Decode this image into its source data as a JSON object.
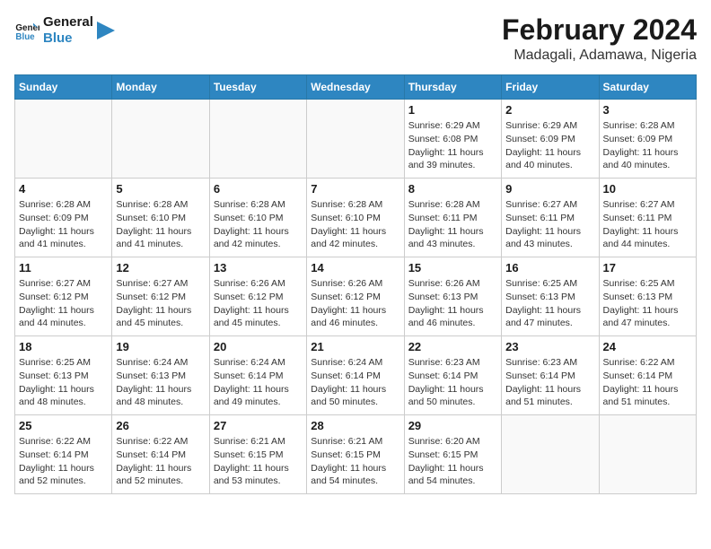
{
  "logo": {
    "text_general": "General",
    "text_blue": "Blue"
  },
  "title": "February 2024",
  "subtitle": "Madagali, Adamawa, Nigeria",
  "days_header": [
    "Sunday",
    "Monday",
    "Tuesday",
    "Wednesday",
    "Thursday",
    "Friday",
    "Saturday"
  ],
  "weeks": [
    [
      {
        "day": "",
        "info": ""
      },
      {
        "day": "",
        "info": ""
      },
      {
        "day": "",
        "info": ""
      },
      {
        "day": "",
        "info": ""
      },
      {
        "day": "1",
        "info": "Sunrise: 6:29 AM\nSunset: 6:08 PM\nDaylight: 11 hours and 39 minutes."
      },
      {
        "day": "2",
        "info": "Sunrise: 6:29 AM\nSunset: 6:09 PM\nDaylight: 11 hours and 40 minutes."
      },
      {
        "day": "3",
        "info": "Sunrise: 6:28 AM\nSunset: 6:09 PM\nDaylight: 11 hours and 40 minutes."
      }
    ],
    [
      {
        "day": "4",
        "info": "Sunrise: 6:28 AM\nSunset: 6:09 PM\nDaylight: 11 hours and 41 minutes."
      },
      {
        "day": "5",
        "info": "Sunrise: 6:28 AM\nSunset: 6:10 PM\nDaylight: 11 hours and 41 minutes."
      },
      {
        "day": "6",
        "info": "Sunrise: 6:28 AM\nSunset: 6:10 PM\nDaylight: 11 hours and 42 minutes."
      },
      {
        "day": "7",
        "info": "Sunrise: 6:28 AM\nSunset: 6:10 PM\nDaylight: 11 hours and 42 minutes."
      },
      {
        "day": "8",
        "info": "Sunrise: 6:28 AM\nSunset: 6:11 PM\nDaylight: 11 hours and 43 minutes."
      },
      {
        "day": "9",
        "info": "Sunrise: 6:27 AM\nSunset: 6:11 PM\nDaylight: 11 hours and 43 minutes."
      },
      {
        "day": "10",
        "info": "Sunrise: 6:27 AM\nSunset: 6:11 PM\nDaylight: 11 hours and 44 minutes."
      }
    ],
    [
      {
        "day": "11",
        "info": "Sunrise: 6:27 AM\nSunset: 6:12 PM\nDaylight: 11 hours and 44 minutes."
      },
      {
        "day": "12",
        "info": "Sunrise: 6:27 AM\nSunset: 6:12 PM\nDaylight: 11 hours and 45 minutes."
      },
      {
        "day": "13",
        "info": "Sunrise: 6:26 AM\nSunset: 6:12 PM\nDaylight: 11 hours and 45 minutes."
      },
      {
        "day": "14",
        "info": "Sunrise: 6:26 AM\nSunset: 6:12 PM\nDaylight: 11 hours and 46 minutes."
      },
      {
        "day": "15",
        "info": "Sunrise: 6:26 AM\nSunset: 6:13 PM\nDaylight: 11 hours and 46 minutes."
      },
      {
        "day": "16",
        "info": "Sunrise: 6:25 AM\nSunset: 6:13 PM\nDaylight: 11 hours and 47 minutes."
      },
      {
        "day": "17",
        "info": "Sunrise: 6:25 AM\nSunset: 6:13 PM\nDaylight: 11 hours and 47 minutes."
      }
    ],
    [
      {
        "day": "18",
        "info": "Sunrise: 6:25 AM\nSunset: 6:13 PM\nDaylight: 11 hours and 48 minutes."
      },
      {
        "day": "19",
        "info": "Sunrise: 6:24 AM\nSunset: 6:13 PM\nDaylight: 11 hours and 48 minutes."
      },
      {
        "day": "20",
        "info": "Sunrise: 6:24 AM\nSunset: 6:14 PM\nDaylight: 11 hours and 49 minutes."
      },
      {
        "day": "21",
        "info": "Sunrise: 6:24 AM\nSunset: 6:14 PM\nDaylight: 11 hours and 50 minutes."
      },
      {
        "day": "22",
        "info": "Sunrise: 6:23 AM\nSunset: 6:14 PM\nDaylight: 11 hours and 50 minutes."
      },
      {
        "day": "23",
        "info": "Sunrise: 6:23 AM\nSunset: 6:14 PM\nDaylight: 11 hours and 51 minutes."
      },
      {
        "day": "24",
        "info": "Sunrise: 6:22 AM\nSunset: 6:14 PM\nDaylight: 11 hours and 51 minutes."
      }
    ],
    [
      {
        "day": "25",
        "info": "Sunrise: 6:22 AM\nSunset: 6:14 PM\nDaylight: 11 hours and 52 minutes."
      },
      {
        "day": "26",
        "info": "Sunrise: 6:22 AM\nSunset: 6:14 PM\nDaylight: 11 hours and 52 minutes."
      },
      {
        "day": "27",
        "info": "Sunrise: 6:21 AM\nSunset: 6:15 PM\nDaylight: 11 hours and 53 minutes."
      },
      {
        "day": "28",
        "info": "Sunrise: 6:21 AM\nSunset: 6:15 PM\nDaylight: 11 hours and 54 minutes."
      },
      {
        "day": "29",
        "info": "Sunrise: 6:20 AM\nSunset: 6:15 PM\nDaylight: 11 hours and 54 minutes."
      },
      {
        "day": "",
        "info": ""
      },
      {
        "day": "",
        "info": ""
      }
    ]
  ]
}
